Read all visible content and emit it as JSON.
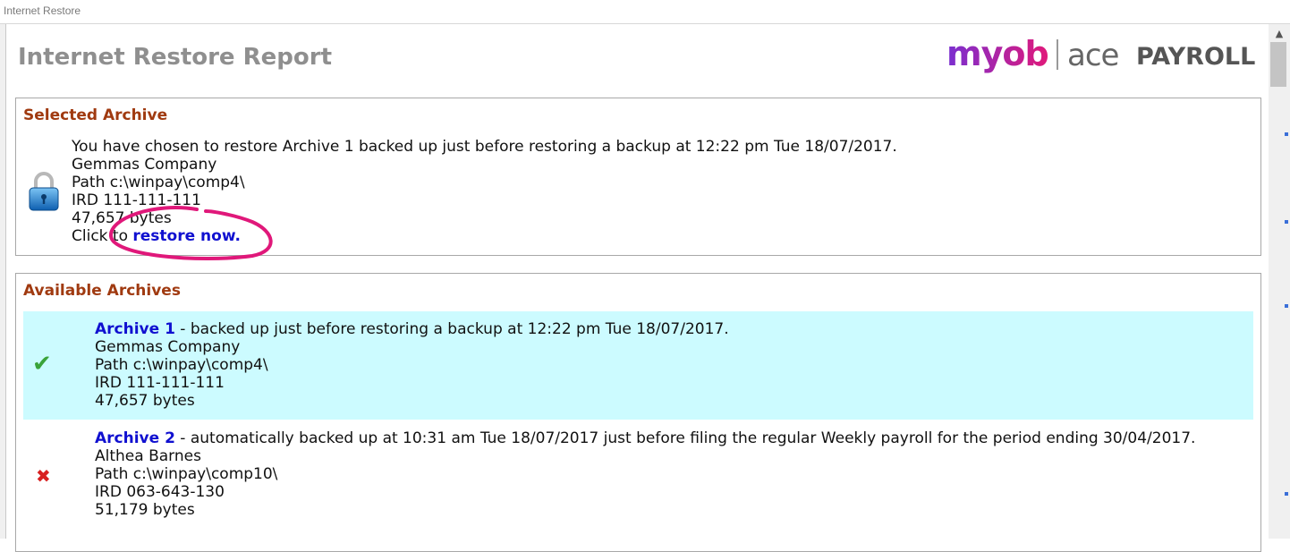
{
  "window": {
    "title": "Internet Restore"
  },
  "header": {
    "title": "Internet Restore Report",
    "logo": {
      "brand": "myob",
      "product_a": "ace",
      "product_b": "PAYROLL"
    }
  },
  "selected_archive": {
    "heading": "Selected Archive",
    "line1": "You have chosen to restore Archive 1 backed up just before restoring a backup at 12:22 pm Tue 18/07/2017.",
    "company": "Gemmas Company",
    "path": "Path c:\\winpay\\comp4\\",
    "ird": "IRD 111-111-111",
    "size": "47,657 bytes",
    "restore_prefix": "Click to ",
    "restore_link": "restore now.",
    "icon": "padlock-icon"
  },
  "available_archives": {
    "heading": "Available Archives",
    "items": [
      {
        "name": "Archive 1",
        "desc": " - backed up just before restoring a backup at 12:22 pm Tue 18/07/2017.",
        "company": "Gemmas Company",
        "path": "Path c:\\winpay\\comp4\\",
        "ird": "IRD 111-111-111",
        "size": "47,657 bytes",
        "status_icon": "check-icon",
        "status_symbol": "✔"
      },
      {
        "name": "Archive 2",
        "desc": " - automatically backed up at 10:31 am Tue 18/07/2017 just before filing the regular Weekly payroll for the period ending 30/04/2017.",
        "company": "Althea Barnes",
        "path": "Path c:\\winpay\\comp10\\",
        "ird": "IRD 063-643-130",
        "size": "51,179 bytes",
        "status_icon": "cross-icon",
        "status_symbol": "✖"
      }
    ]
  },
  "colors": {
    "heading": "#a03a10",
    "link": "#1010d0",
    "selected_row_bg": "#ccfbff",
    "annotation": "#e0187a",
    "logo_brand": "#8c2bc4"
  }
}
